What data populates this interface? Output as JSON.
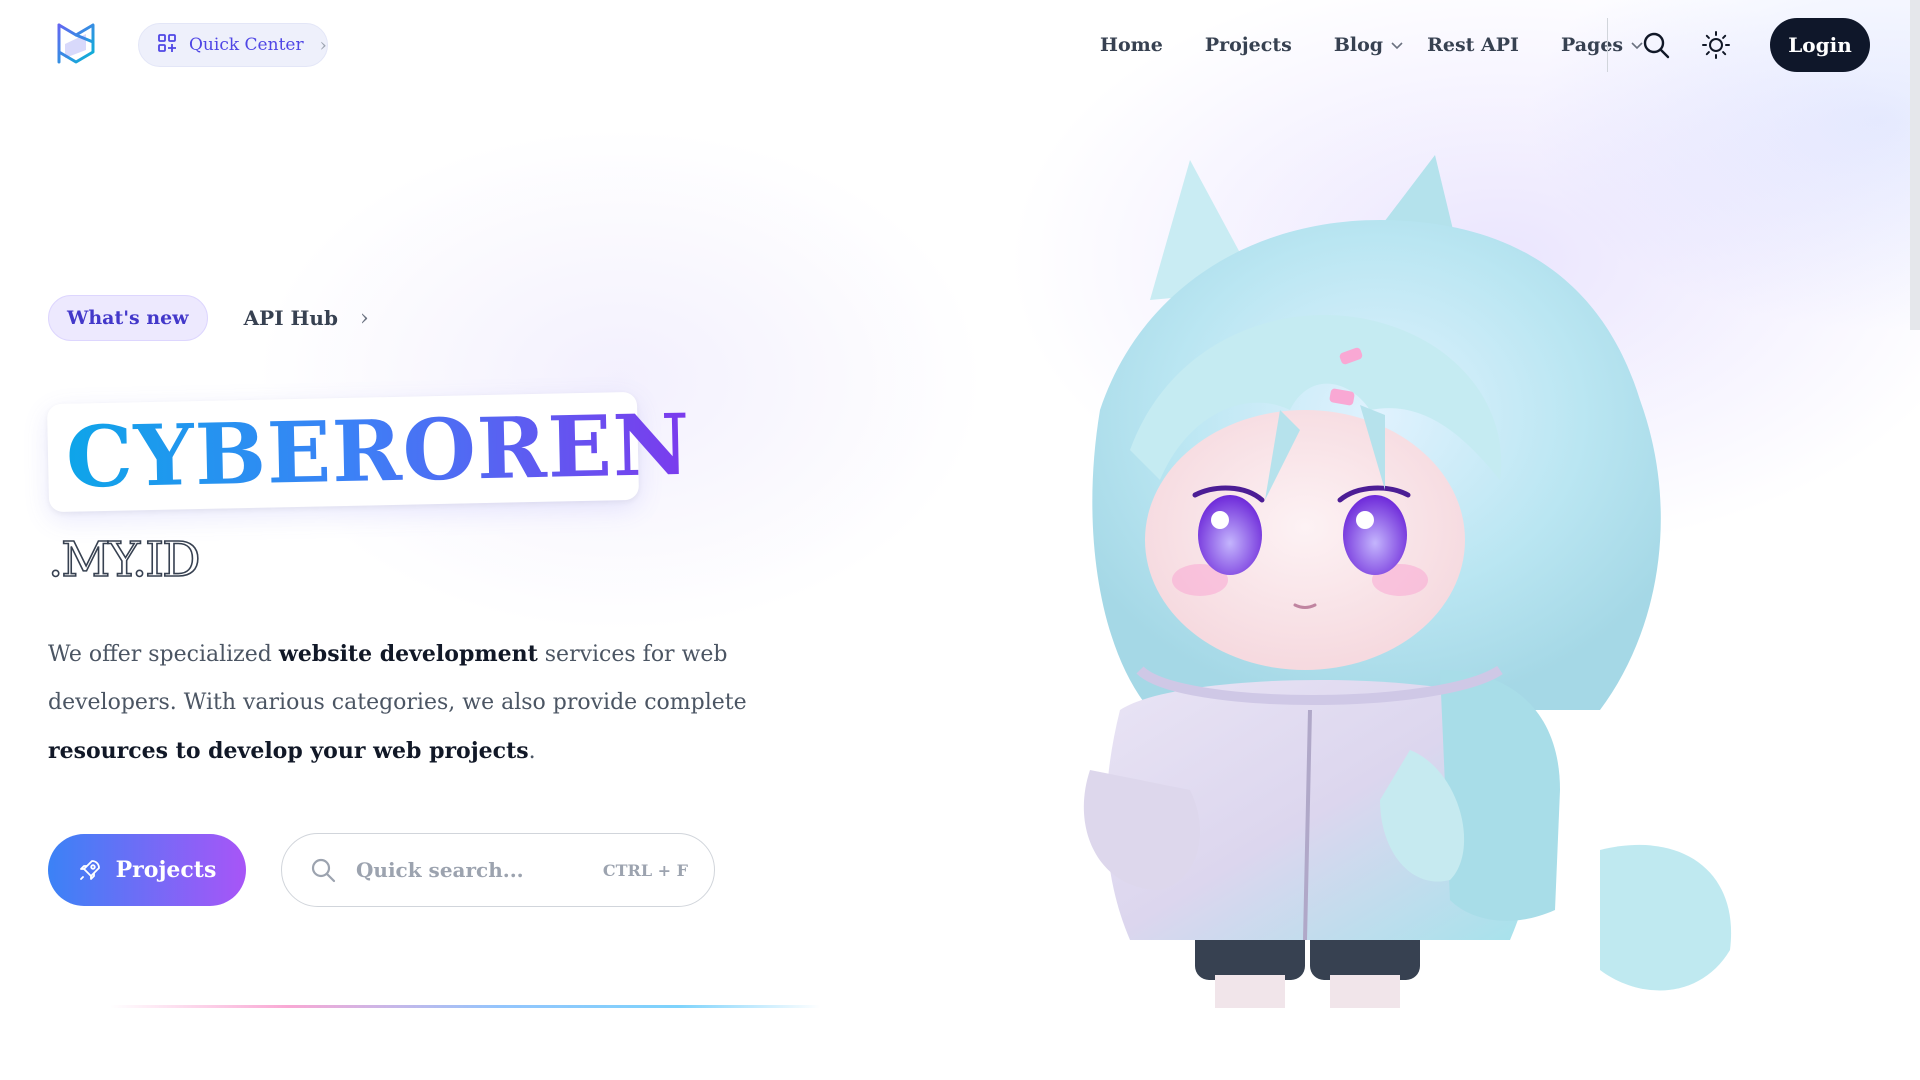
{
  "nav": {
    "quick_center": "Quick Center",
    "links": [
      {
        "label": "Home",
        "has_dropdown": false
      },
      {
        "label": "Projects",
        "has_dropdown": false
      },
      {
        "label": "Blog",
        "has_dropdown": true
      },
      {
        "label": "Rest API",
        "has_dropdown": false
      },
      {
        "label": "Pages",
        "has_dropdown": true
      }
    ],
    "login": "Login",
    "icons": {
      "logo": "brand-logo-icon",
      "search": "search-icon",
      "theme": "sun-icon",
      "grid": "grid-plus-icon"
    }
  },
  "hero": {
    "badge": "What's new",
    "link": "API Hub",
    "title": "CYBEROREN",
    "subtitle": ".MY.ID",
    "description": {
      "t1": "We offer specialized ",
      "b1": "website development",
      "t2": " services for web developers. With various categories, we also provide complete ",
      "b2": "resources to develop your web projects",
      "t3": "."
    },
    "projects_button": "Projects",
    "search": {
      "placeholder": "Quick search...",
      "shortcut": "CTRL + F"
    }
  },
  "colors": {
    "accent": "#4f46e5",
    "gradient_start": "#3b82f6",
    "gradient_end": "#a855f7",
    "login_bg": "#0f172a"
  }
}
